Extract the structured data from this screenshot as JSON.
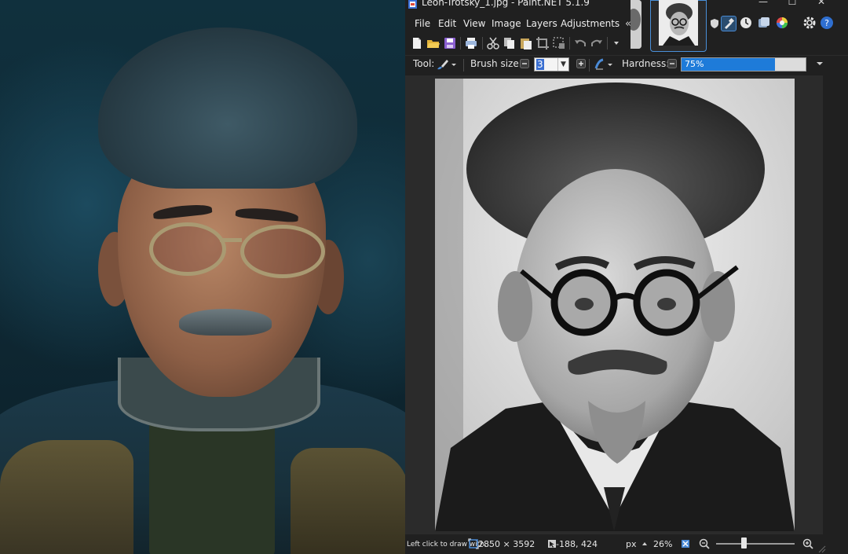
{
  "window": {
    "title": "Leon-Trotsky_1.jpg - Paint.NET 5.1.9",
    "minimize_icon": "minimize-icon",
    "maximize_icon": "maximize-icon",
    "close_icon": "close-icon"
  },
  "menu": {
    "items": [
      "File",
      "Edit",
      "View",
      "Image",
      "Layers",
      "Adjustments"
    ]
  },
  "toolbar": {
    "icons": [
      "new-file-icon",
      "open-folder-icon",
      "save-icon",
      "print-icon",
      "cut-icon",
      "copy-icon",
      "paste-icon",
      "crop-icon",
      "deselect-icon",
      "undo-icon",
      "redo-icon",
      "more-dropdown-icon"
    ]
  },
  "side_icons": [
    "image-list-collapse-icon",
    "shield-icon",
    "tools-icon",
    "history-icon",
    "layers-icon",
    "colors-icon",
    "settings-icon",
    "help-icon"
  ],
  "tool_options": {
    "tool_label": "Tool:",
    "brush_size_label": "Brush size:",
    "brush_size_value": "3",
    "hardness_label": "Hardness:",
    "hardness_value": "75%",
    "hardness_fraction": 0.75
  },
  "status": {
    "hint": "Left click to draw with...",
    "image_size": "2850 × 3592",
    "cursor_position": "-188, 424",
    "units": "px",
    "zoom": "26%",
    "zoom_fraction": 0.35
  },
  "colors": {
    "accent": "#1e7bd9",
    "window_bg": "#202020",
    "text": "#eaeaea"
  }
}
